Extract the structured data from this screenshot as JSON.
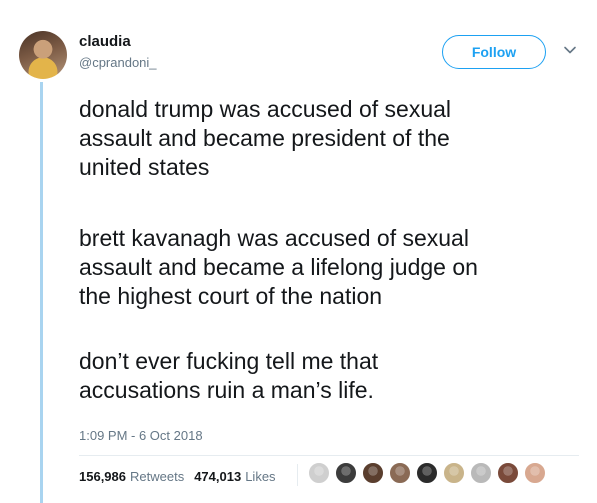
{
  "user": {
    "display_name": "claudia",
    "screen_name": "@cprandoni_"
  },
  "follow_label": "Follow",
  "tweet": {
    "paragraph1": [
      "donald trump was accused of sexual",
      "assault and became president of the",
      "united states"
    ],
    "paragraph2": [
      "brett kavanagh was accused of sexual",
      "assault and became a lifelong judge on",
      "the highest court of the nation"
    ],
    "paragraph3": [
      "don’t ever fucking tell me that",
      "accusations ruin a man’s life."
    ]
  },
  "timestamp": "1:09 PM - 6 Oct 2018",
  "stats": {
    "retweets_count": "156,986",
    "retweets_label": "Retweets",
    "likes_count": "474,013",
    "likes_label": "Likes"
  },
  "likers": [
    {
      "name": "liker-avatar-1",
      "color": "#cfcfcf"
    },
    {
      "name": "liker-avatar-2",
      "color": "#3c3c3c"
    },
    {
      "name": "liker-avatar-3",
      "color": "#5a3e2e"
    },
    {
      "name": "liker-avatar-4",
      "color": "#8a6a55"
    },
    {
      "name": "liker-avatar-5",
      "color": "#2b2b2b"
    },
    {
      "name": "liker-avatar-6",
      "color": "#c9b48a"
    },
    {
      "name": "liker-avatar-7",
      "color": "#b9b9b9"
    },
    {
      "name": "liker-avatar-8",
      "color": "#7a4a3a"
    },
    {
      "name": "liker-avatar-9",
      "color": "#d8a890"
    }
  ],
  "colors": {
    "accent": "#1da1f2",
    "thread_line": "#a9d4f0",
    "secondary_text": "#657786"
  }
}
